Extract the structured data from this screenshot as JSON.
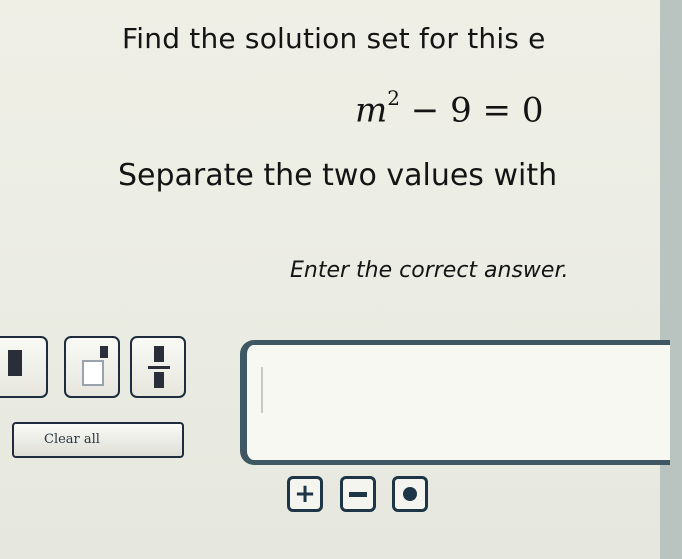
{
  "question": {
    "line1": "Find the solution set for this e",
    "equation": {
      "variable": "m",
      "exponent": "2",
      "rest": " − 9 = 0"
    },
    "line2": "Separate the two values with",
    "instruction": "Enter the correct answer."
  },
  "toolbar": {
    "buttons": [
      "single-box-icon",
      "exponent-icon",
      "fraction-icon"
    ],
    "clear_label": "Clear all"
  },
  "answer": {
    "value": ""
  },
  "keys": [
    {
      "name": "plus-icon",
      "glyph": "+"
    },
    {
      "name": "minus-icon"
    },
    {
      "name": "dot-icon"
    }
  ],
  "colors": {
    "background": "#ecede4",
    "border": "#1e2c3e",
    "answer_border": "#3f5663",
    "right_strip": "#b9c4c0"
  }
}
